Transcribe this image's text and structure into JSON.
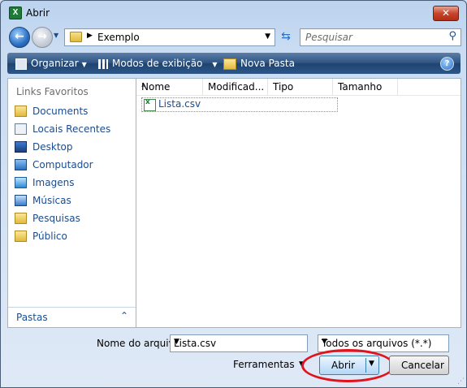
{
  "window": {
    "title": "Abrir",
    "app_icon": "excel-icon",
    "close_symbol": "✕"
  },
  "address_bar": {
    "path": "Exemplo",
    "search_placeholder": "Pesquisar"
  },
  "toolbar": {
    "organize": "Organizar",
    "views": "Modos de exibição",
    "new_folder": "Nova Pasta",
    "help_symbol": "?"
  },
  "navigation": {
    "heading": "Links Favoritos",
    "items": [
      {
        "label": "Documents",
        "icon": "folder-icon"
      },
      {
        "label": "Locais Recentes",
        "icon": "recent-places-icon"
      },
      {
        "label": "Desktop",
        "icon": "desktop-icon"
      },
      {
        "label": "Computador",
        "icon": "computer-icon"
      },
      {
        "label": "Imagens",
        "icon": "pictures-icon"
      },
      {
        "label": "Músicas",
        "icon": "music-icon"
      },
      {
        "label": "Pesquisas",
        "icon": "folder-icon"
      },
      {
        "label": "Público",
        "icon": "folder-icon"
      }
    ],
    "folders_label": "Pastas"
  },
  "file_list": {
    "columns": [
      "Nome",
      "Modificad...",
      "Tipo",
      "Tamanho"
    ],
    "files": [
      {
        "name": "Lista.csv",
        "icon": "csv-file-icon"
      }
    ]
  },
  "bottom": {
    "filename_label": "Nome do arquivo:",
    "filename_value": "Lista.csv",
    "filetype_value": "Todos os arquivos (*.*)",
    "tools_label": "Ferramentas",
    "open_button": "Abrir",
    "cancel_button": "Cancelar"
  },
  "colors": {
    "highlight": "#e0141e",
    "toolbar": "#2e5482",
    "link": "#1b4c8f"
  }
}
